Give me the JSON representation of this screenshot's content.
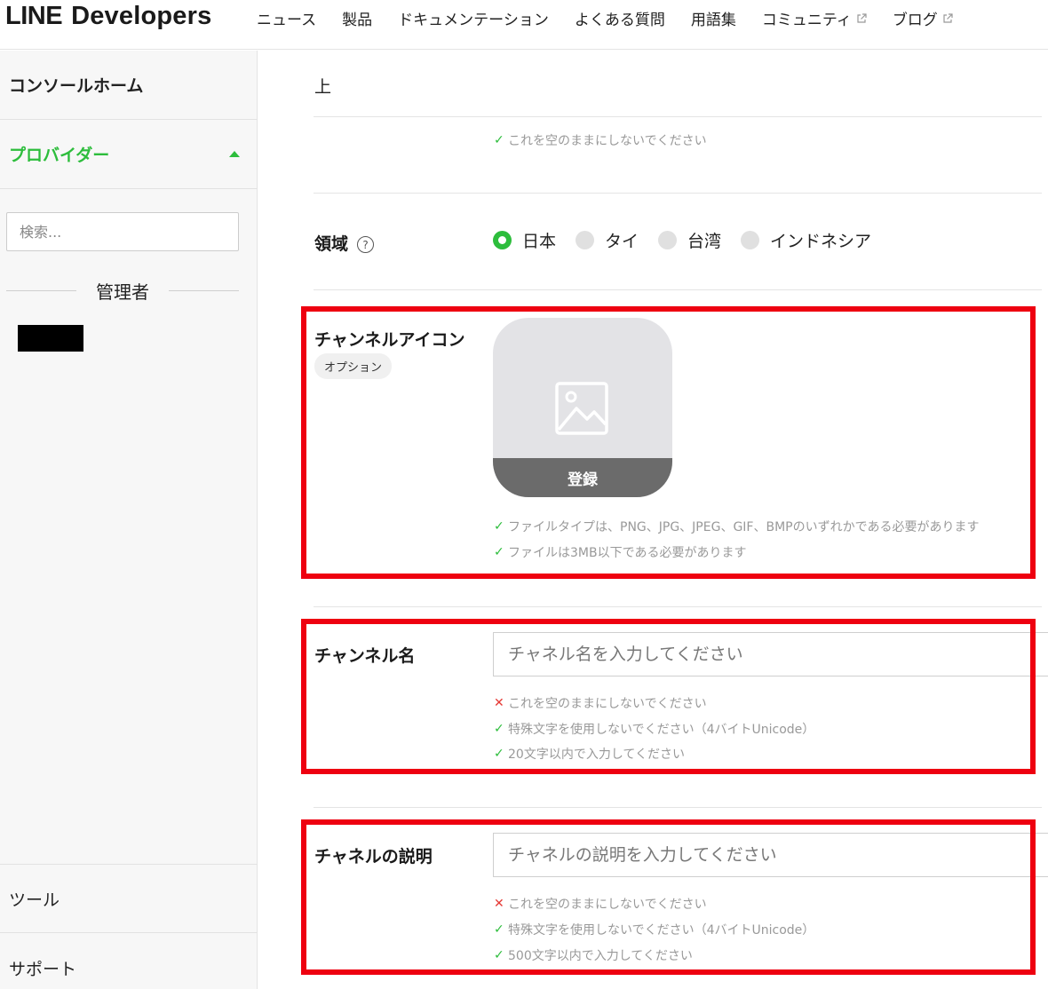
{
  "header": {
    "logo_line": "LINE",
    "logo_dev": "Developers",
    "nav": [
      {
        "label": "ニュース"
      },
      {
        "label": "製品"
      },
      {
        "label": "ドキュメンテーション"
      },
      {
        "label": "よくある質問"
      },
      {
        "label": "用語集"
      },
      {
        "label": "コミュニティ",
        "external": true
      },
      {
        "label": "ブログ",
        "external": true
      }
    ]
  },
  "sidebar": {
    "home": "コンソールホーム",
    "provider": "プロバイダー",
    "search_placeholder": "検索...",
    "admin_label": "管理者",
    "tools": "ツール",
    "support": "サポート"
  },
  "form": {
    "top_value": "上",
    "top_hint": "これを空のままにしないでください",
    "region": {
      "label": "領域",
      "options": [
        {
          "label": "日本",
          "selected": true
        },
        {
          "label": "タイ",
          "selected": false
        },
        {
          "label": "台湾",
          "selected": false
        },
        {
          "label": "インドネシア",
          "selected": false
        }
      ]
    },
    "icon": {
      "label": "チャンネルアイコン",
      "optional": "オプション",
      "register": "登録",
      "hints": [
        "ファイルタイプは、PNG、JPG、JPEG、GIF、BMPのいずれかである必要があります",
        "ファイルは3MB以下である必要があります"
      ]
    },
    "channel_name": {
      "label": "チャンネル名",
      "placeholder": "チャネル名を入力してください",
      "hints": [
        {
          "text": "これを空のままにしないでください",
          "status": "error"
        },
        {
          "text": "特殊文字を使用しないでください（4バイトUnicode）",
          "status": "ok"
        },
        {
          "text": "20文字以内で入力してください",
          "status": "ok"
        }
      ]
    },
    "channel_desc": {
      "label": "チャネルの説明",
      "placeholder": "チャネルの説明を入力してください",
      "hints": [
        {
          "text": "これを空のままにしないでください",
          "status": "error"
        },
        {
          "text": "特殊文字を使用しないでください（4バイトUnicode）",
          "status": "ok"
        },
        {
          "text": "500文字以内で入力してください",
          "status": "ok"
        }
      ]
    }
  },
  "colors": {
    "accent_green": "#2dbd3c",
    "highlight_red": "#ee0010",
    "error_red": "#e53935"
  }
}
